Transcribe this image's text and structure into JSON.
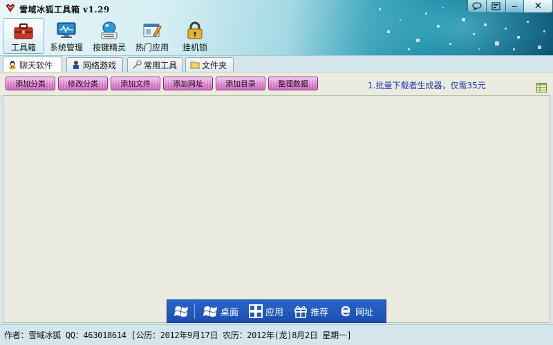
{
  "window": {
    "title": "雪域冰狐工具箱 v1.29",
    "controls": [
      "chat-icon",
      "skin-icon",
      "minimize-icon",
      "close-icon"
    ],
    "close_label": "✕",
    "minimize_label": "−"
  },
  "main_toolbar": {
    "items": [
      {
        "label": "工具箱",
        "icon": "toolbox-icon",
        "active": true
      },
      {
        "label": "系统管理",
        "icon": "monitor-icon",
        "active": false
      },
      {
        "label": "按键精灵",
        "icon": "keyboard-icon",
        "active": false
      },
      {
        "label": "热门应用",
        "icon": "apps-icon",
        "active": false
      },
      {
        "label": "挂机锁",
        "icon": "lock-icon",
        "active": false
      }
    ]
  },
  "tabs": [
    {
      "label": "聊天软件",
      "icon": "chat-person-icon",
      "active": true
    },
    {
      "label": "网络游戏",
      "icon": "game-person-icon",
      "active": false
    },
    {
      "label": "常用工具",
      "icon": "wrench-icon",
      "active": false
    },
    {
      "label": "文件夹",
      "icon": "folder-icon",
      "active": false
    }
  ],
  "actions": {
    "buttons": [
      "添加分类",
      "修改分类",
      "添加文件",
      "添加网址",
      "添加目录",
      "整理数据"
    ],
    "promo_text": "1.批量下载者生成器，仅需35元"
  },
  "quickbar": {
    "items": [
      {
        "label": "",
        "icon": "windows-icon"
      },
      {
        "label": "桌面",
        "icon": "windows-icon"
      },
      {
        "label": "应用",
        "icon": "grid-icon"
      },
      {
        "label": "推荐",
        "icon": "gift-icon"
      },
      {
        "label": "网址",
        "icon": "ie-icon"
      }
    ]
  },
  "status": {
    "text": "作者：雪域冰狐 QQ：463018614 [公历：2012年9月17日 农历：2012年(龙)8月2日 星期一]"
  },
  "colors": {
    "header_dark": "#0a5473",
    "header_light": "#e8f6f9",
    "button_pink": "#d779c8",
    "promo_blue": "#1838b8",
    "content_bg": "#ecebdf",
    "quickbar_blue": "#1b4fb0"
  }
}
